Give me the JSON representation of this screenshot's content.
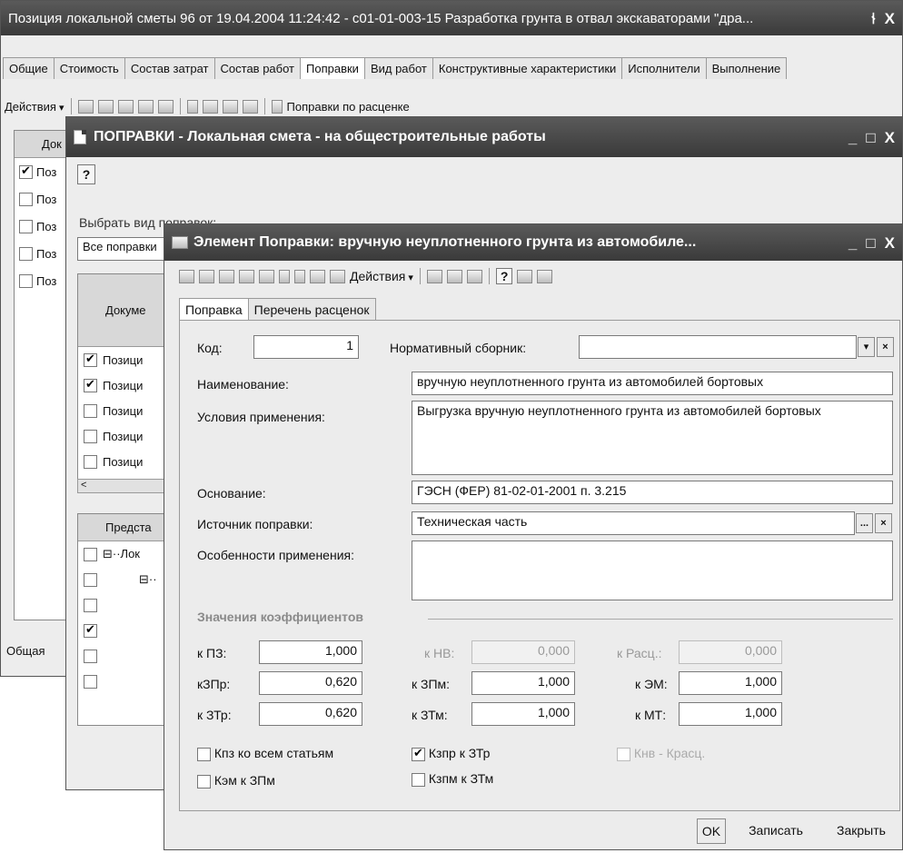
{
  "w1": {
    "title": "Позиция локальной сметы 96 от 19.04.2004 11:24:42 - с01-01-003-15   Разработка грунта в отвал экскаваторами \"дра...",
    "pin": "⫮",
    "close": "X",
    "tabs": [
      "Общие",
      "Стоимость",
      "Состав затрат",
      "Состав работ",
      "Поправки",
      "Вид работ",
      "Конструктивные характеристики",
      "Исполнители",
      "Выполнение"
    ],
    "actions": "Действия",
    "toolbar_text": "Поправки по расценке",
    "grid_header": "Док",
    "rows": [
      "Поз",
      "Поз",
      "Поз",
      "Поз",
      "Поз"
    ],
    "footer": "Общая"
  },
  "w2": {
    "title": "ПОПРАВКИ - Локальная смета - на общестроительные работы",
    "help": "?",
    "min": "_",
    "max": "□",
    "close": "X",
    "choose_label": "Выбрать вид поправок:",
    "filter": "Все поправки",
    "grid_header": "Докуме",
    "rows": [
      "Позици",
      "Позици",
      "Позици",
      "Позици",
      "Позици"
    ],
    "scroll_left": "<",
    "tree_header": "Предста",
    "tree_rows": [
      "⊟··Лок",
      "⊟··"
    ]
  },
  "w3": {
    "title": "Элемент Поправки: вручную неуплотненного грунта из автомобиле...",
    "min": "_",
    "max": "□",
    "close": "X",
    "actions": "Действия",
    "help": "?",
    "tabs": [
      "Поправка",
      "Перечень расценок"
    ],
    "kod_label": "Код:",
    "kod_value": "1",
    "sbornik_label": "Нормативный сборник:",
    "sbornik_value": "",
    "name_label": "Наименование:",
    "name_value": "вручную неуплотненного грунта из автомобилей бортовых",
    "usl_label": "Условия применения:",
    "usl_value": "Выгрузка вручную неуплотненного грунта из автомобилей бортовых",
    "osn_label": "Основание:",
    "osn_value": "ГЭСН (ФЕР) 81-02-01-2001 п. 3.215",
    "ist_label": "Источник поправки:",
    "ist_value": "Техническая часть",
    "osob_label": "Особенности применения:",
    "osob_value": "",
    "coef_header": "Значения коэффициентов",
    "k": {
      "pz_l": "к ПЗ:",
      "pz_v": "1,000",
      "nv_l": "к НВ:",
      "nv_v": "0,000",
      "rasc_l": "к Расц.:",
      "rasc_v": "0,000",
      "zpr_l": "кЗПр:",
      "zpr_v": "0,620",
      "zpm_l": "к ЗПм:",
      "zpm_v": "1,000",
      "em_l": "к ЭМ:",
      "em_v": "1,000",
      "ztr_l": "к ЗТр:",
      "ztr_v": "0,620",
      "ztm_l": "к ЗТм:",
      "ztm_v": "1,000",
      "mt_l": "к МТ:",
      "mt_v": "1,000"
    },
    "chk": {
      "kpz": "Кпз ко всем статьям",
      "kzpr": "Кзпр к ЗТр",
      "knv": "Кнв - Красц.",
      "kem": "Кэм к ЗПм",
      "kzpm": "Кзпм к ЗТм"
    },
    "ok": "OK",
    "save": "Записать",
    "close_btn": "Закрыть",
    "dots": "...",
    "x": "×",
    "dd": "▾"
  },
  "colors": {
    "titlebar": "#4a4a4a",
    "window_bg": "#ededed",
    "section_header": "#8a8a8a"
  }
}
